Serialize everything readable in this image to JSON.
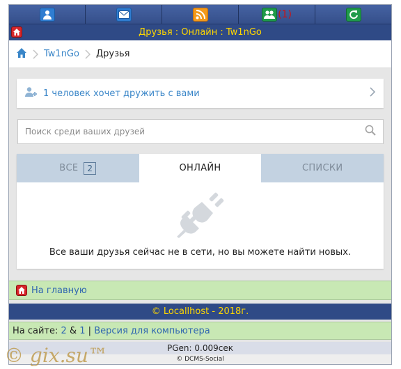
{
  "topbar": {
    "items": [
      {
        "icon": "user-icon"
      },
      {
        "icon": "mail-icon"
      },
      {
        "icon": "rss-icon"
      },
      {
        "icon": "friends-icon",
        "count": "(1)"
      },
      {
        "icon": "refresh-icon"
      }
    ]
  },
  "title": "Друзья : Онлайн : Tw1nGo",
  "breadcrumb": {
    "user": "Tw1nGo",
    "current": "Друзья"
  },
  "friend_request": {
    "text": "1 человек хочет дружить с вами"
  },
  "search": {
    "placeholder": "Поиск среди ваших друзей",
    "value": ""
  },
  "tabs": {
    "all": {
      "label": "ВСЕ",
      "count": "2"
    },
    "online": {
      "label": "ОНЛАЙН"
    },
    "lists": {
      "label": "СПИСКИ"
    }
  },
  "empty_message": "Все ваши друзья сейчас не в сети, но вы можете найти новых.",
  "footer": {
    "home_label": "На главную",
    "copyright": "© Locallhost - 2018г.",
    "online_prefix": "На сайте:",
    "online_users": "2",
    "online_amp": "&",
    "online_guests": "1",
    "online_sep": "|",
    "desktop_version": "Версия для компьютера",
    "pgen": "PGen: 0.009сек",
    "engine": "© DCMS-Social"
  },
  "watermark": "© gix.su™",
  "colors": {
    "header_bg": "#2f4a86",
    "header_text": "#ffd700",
    "link": "#3a86c8",
    "footer_green": "#c8e8b4",
    "tab_inactive": "#c3d2e1"
  }
}
